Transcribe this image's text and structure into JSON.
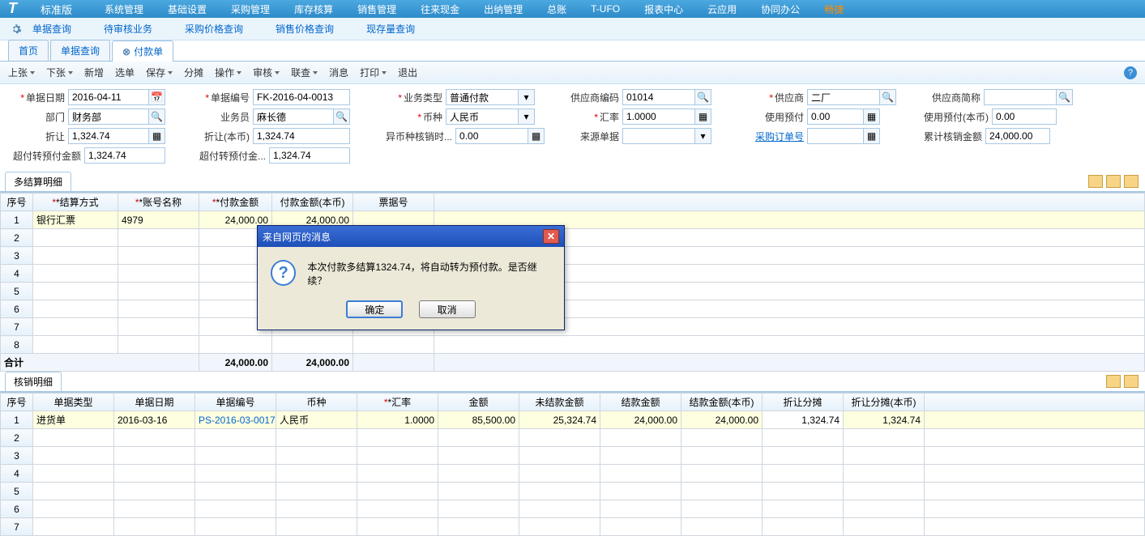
{
  "topnav": {
    "brand": "标准版",
    "items": [
      "系统管理",
      "基础设置",
      "采购管理",
      "库存核算",
      "销售管理",
      "往来现金",
      "出纳管理",
      "总账",
      "T-UFO",
      "报表中心",
      "云应用",
      "协同办公"
    ],
    "highlight": "畅捷"
  },
  "subnav": {
    "items": [
      "单据查询",
      "待审核业务",
      "采购价格查询",
      "销售价格查询",
      "现存量查询"
    ]
  },
  "tabs": {
    "items": [
      "首页",
      "单据查询",
      "付款单"
    ],
    "active": 2
  },
  "toolbar": {
    "items": [
      "上张",
      "下张",
      "新增",
      "选单",
      "保存",
      "分摊",
      "操作",
      "审核",
      "联查",
      "消息",
      "打印",
      "退出"
    ],
    "dropdown": [
      true,
      true,
      false,
      false,
      true,
      false,
      true,
      true,
      true,
      false,
      true,
      false
    ]
  },
  "form": {
    "f1": {
      "label": "单据日期",
      "value": "2016-04-11",
      "req": true
    },
    "f2": {
      "label": "单据编号",
      "value": "FK-2016-04-0013",
      "req": true
    },
    "f3": {
      "label": "业务类型",
      "value": "普通付款",
      "req": true
    },
    "f4": {
      "label": "供应商编码",
      "value": "01014"
    },
    "f5": {
      "label": "供应商",
      "value": "二厂",
      "req": true
    },
    "f6": {
      "label": "供应商简称",
      "value": ""
    },
    "f7": {
      "label": "部门",
      "value": "财务部"
    },
    "f8": {
      "label": "业务员",
      "value": "麻长德"
    },
    "f9": {
      "label": "币种",
      "value": "人民币",
      "req": true
    },
    "f10": {
      "label": "汇率",
      "value": "1.0000",
      "req": true
    },
    "f11": {
      "label": "使用预付",
      "value": "0.00"
    },
    "f12": {
      "label": "使用预付(本币)",
      "value": "0.00"
    },
    "f13": {
      "label": "折让",
      "value": "1,324.74"
    },
    "f14": {
      "label": "折让(本币)",
      "value": "1,324.74"
    },
    "f15": {
      "label": "异币种核销时...",
      "value": "0.00"
    },
    "f16": {
      "label": "来源单据",
      "value": ""
    },
    "f17": {
      "label": "采购订单号",
      "value": ""
    },
    "f18": {
      "label": "累计核销金额",
      "value": "24,000.00"
    },
    "f19": {
      "label": "超付转预付金额",
      "value": "1,324.74"
    },
    "f20": {
      "label": "超付转预付金...",
      "value": "1,324.74"
    }
  },
  "grid1": {
    "tab": "多结算明细",
    "headers": [
      "序号",
      "*结算方式",
      "*账号名称",
      "*付款金额",
      "付款金额(本币)",
      "票据号"
    ],
    "row": {
      "no": "1",
      "method": "银行汇票",
      "account": "4979",
      "amount": "24,000.00",
      "amount_local": "24,000.00",
      "bill": ""
    },
    "total_label": "合计",
    "total_amount": "24,000.00",
    "total_local": "24,000.00"
  },
  "grid2": {
    "tab": "核销明细",
    "headers": [
      "序号",
      "单据类型",
      "单据日期",
      "单据编号",
      "币种",
      "*汇率",
      "金额",
      "未结款金额",
      "结款金额",
      "结款金额(本币)",
      "折让分摊",
      "折让分摊(本币)"
    ],
    "row": {
      "no": "1",
      "type": "进货单",
      "date": "2016-03-16",
      "code": "PS-2016-03-0017",
      "currency": "人民币",
      "rate": "1.0000",
      "amount": "85,500.00",
      "unpaid": "25,324.74",
      "paid": "24,000.00",
      "paid_local": "24,000.00",
      "discount": "1,324.74",
      "discount_local": "1,324.74"
    }
  },
  "modal": {
    "title": "来自网页的消息",
    "message": "本次付款多结算1324.74，将自动转为预付款。是否继续？",
    "ok": "确定",
    "cancel": "取消"
  }
}
